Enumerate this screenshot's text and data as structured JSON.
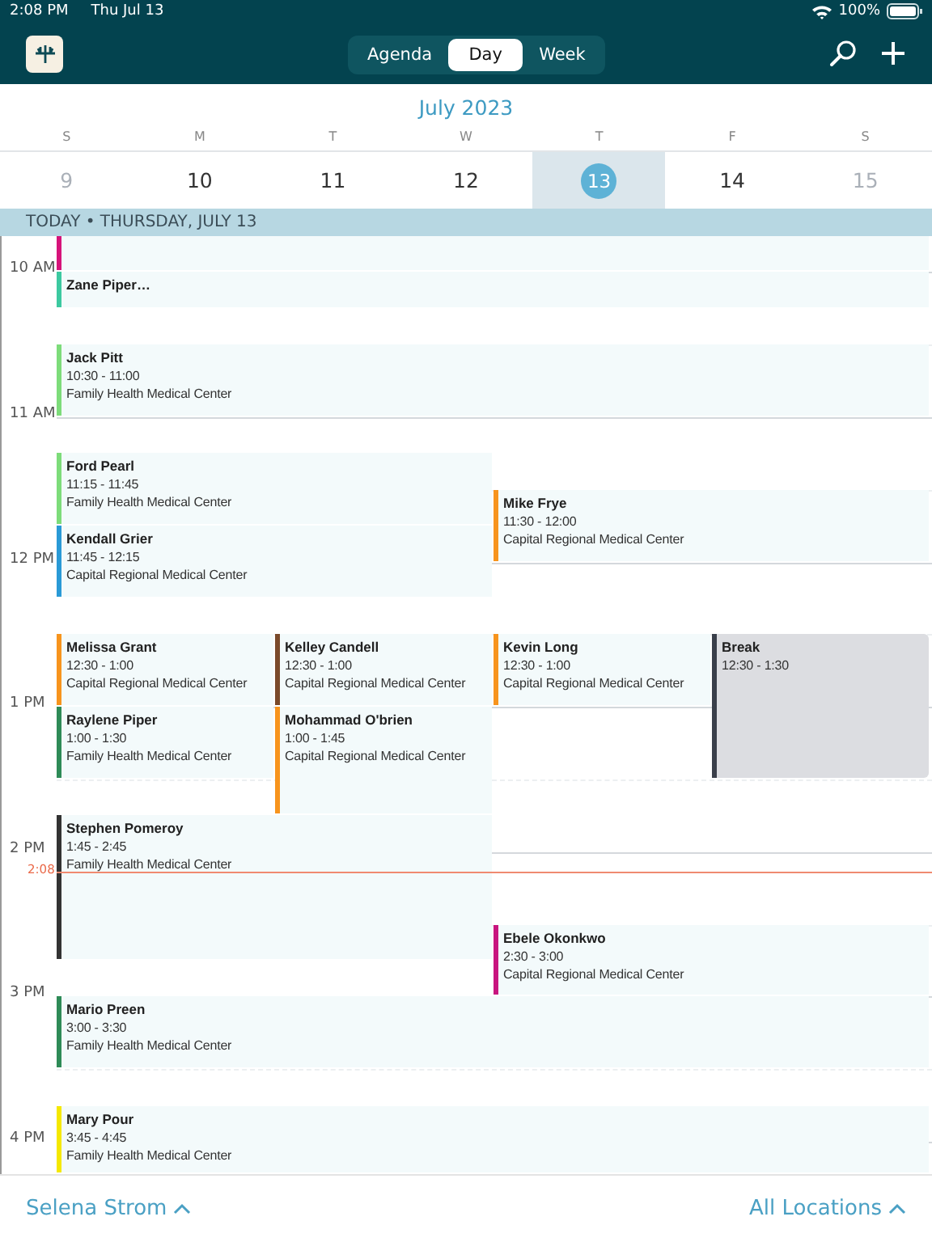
{
  "status_bar": {
    "time": "2:08 PM",
    "date": "Thu Jul 13",
    "battery": "100%"
  },
  "toolbar": {
    "tabs": [
      {
        "label": "Agenda",
        "selected": false
      },
      {
        "label": "Day",
        "selected": true
      },
      {
        "label": "Week",
        "selected": false
      }
    ]
  },
  "month_title": "July 2023",
  "days": [
    {
      "letter": "S",
      "date": "9",
      "selected": false,
      "dimmed": true
    },
    {
      "letter": "M",
      "date": "10",
      "selected": false,
      "dimmed": false
    },
    {
      "letter": "T",
      "date": "11",
      "selected": false,
      "dimmed": false
    },
    {
      "letter": "W",
      "date": "12",
      "selected": false,
      "dimmed": false
    },
    {
      "letter": "T",
      "date": "13",
      "selected": true,
      "dimmed": false
    },
    {
      "letter": "F",
      "date": "14",
      "selected": false,
      "dimmed": false
    },
    {
      "letter": "S",
      "date": "15",
      "selected": false,
      "dimmed": true
    }
  ],
  "today_banner": "TODAY • THURSDAY, JULY 13",
  "hours": [
    "10 AM",
    "11 AM",
    "12 PM",
    "1 PM",
    "2 PM",
    "3 PM",
    "4 PM"
  ],
  "now_marker": "2:08",
  "events": [
    {
      "kind": "appointment",
      "color": "#d6137a"
    },
    {
      "kind": "appointment",
      "name": "Zane Piper…",
      "color": "#3cc9a0"
    },
    {
      "kind": "appointment",
      "name": "Jack Pitt",
      "time": "10:30 - 11:00",
      "location": "Family Health Medical Center",
      "color": "#7ddc7a"
    },
    {
      "kind": "appointment",
      "name": "Ford Pearl",
      "time": "11:15 - 11:45",
      "location": "Family Health Medical Center",
      "color": "#7ddc7a"
    },
    {
      "kind": "appointment",
      "name": "Mike Frye",
      "time": "11:30 - 12:00",
      "location": "Capital Regional Medical Center",
      "color": "#f7941d"
    },
    {
      "kind": "appointment",
      "name": "Kendall Grier",
      "time": "11:45 - 12:15",
      "location": "Capital Regional Medical Center",
      "color": "#2a9ad6"
    },
    {
      "kind": "appointment",
      "name": "Melissa Grant",
      "time": "12:30 - 1:00",
      "location": "Capital Regional Medical Center",
      "color": "#f7941d"
    },
    {
      "kind": "appointment",
      "name": "Kelley Candell",
      "time": "12:30 - 1:00",
      "location": "Capital Regional Medical Center",
      "color": "#7a4a2a"
    },
    {
      "kind": "appointment",
      "name": "Kevin Long",
      "time": "12:30 - 1:00",
      "location": "Capital Regional Medical Center",
      "color": "#f7941d"
    },
    {
      "kind": "break",
      "name": "Break",
      "time": "12:30 - 1:30",
      "color": "#3a3f4a"
    },
    {
      "kind": "appointment",
      "name": "Raylene Piper",
      "time": "1:00 - 1:30",
      "location": "Family Health Medical Center",
      "color": "#2e8b57"
    },
    {
      "kind": "appointment",
      "name": "Mohammad O'brien",
      "time": "1:00 - 1:45",
      "location": "Capital Regional Medical Center",
      "color": "#f7941d"
    },
    {
      "kind": "appointment",
      "name": "Stephen Pomeroy",
      "time": "1:45 - 2:45",
      "location": "Family Health Medical Center",
      "color": "#333333"
    },
    {
      "kind": "appointment",
      "name": "Ebele Okonkwo",
      "time": "2:30 - 3:00",
      "location": "Capital Regional Medical Center",
      "color": "#c8157f"
    },
    {
      "kind": "appointment",
      "name": "Mario Preen",
      "time": "3:00 - 3:30",
      "location": "Family Health Medical Center",
      "color": "#2e8b57"
    },
    {
      "kind": "appointment",
      "name": "Mary Pour",
      "time": "3:45 - 4:45",
      "location": "Family Health Medical Center",
      "color": "#f5e800"
    }
  ],
  "footer": {
    "provider": "Selena Strom",
    "locations": "All Locations"
  }
}
